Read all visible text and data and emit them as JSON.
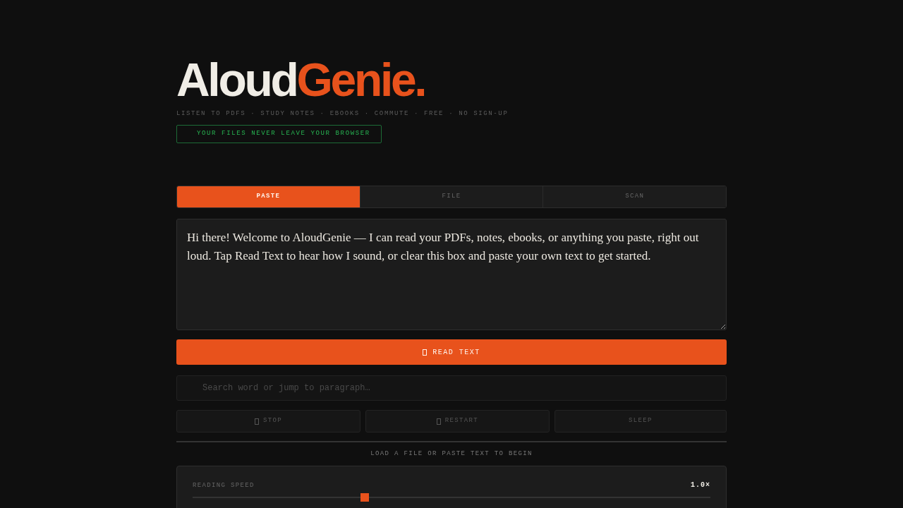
{
  "brand": {
    "primary": "Aloud",
    "accent": "Genie."
  },
  "tagline": "LISTEN TO PDFS · STUDY NOTES · EBOOKS · COMMUTE · FREE · NO SIGN-UP",
  "privacy_badge": "YOUR FILES NEVER LEAVE YOUR BROWSER",
  "tabs": [
    {
      "label": "PASTE",
      "selected": true
    },
    {
      "label": "FILE",
      "selected": false
    },
    {
      "label": "SCAN",
      "selected": false
    }
  ],
  "text_input": {
    "value": "Hi there! Welcome to AloudGenie — I can read your PDFs, notes, ebooks, or anything you paste, right out loud. Tap Read Text to hear how I sound, or clear this box and paste your own text to get started."
  },
  "read_button": {
    "label": "READ TEXT",
    "icon": true
  },
  "search": {
    "placeholder": "Search word or jump to paragraph…"
  },
  "controls": [
    {
      "label": "STOP",
      "icon": true,
      "disabled": true
    },
    {
      "label": "RESTART",
      "icon": true,
      "disabled": true
    },
    {
      "label": "SLEEP",
      "icon": false,
      "disabled": true
    }
  ],
  "status": "LOAD A FILE OR PASTE TEXT TO BEGIN",
  "settings": {
    "sliders": [
      {
        "label": "READING SPEED",
        "reading": "1.0×",
        "level": 0.333
      }
    ]
  }
}
